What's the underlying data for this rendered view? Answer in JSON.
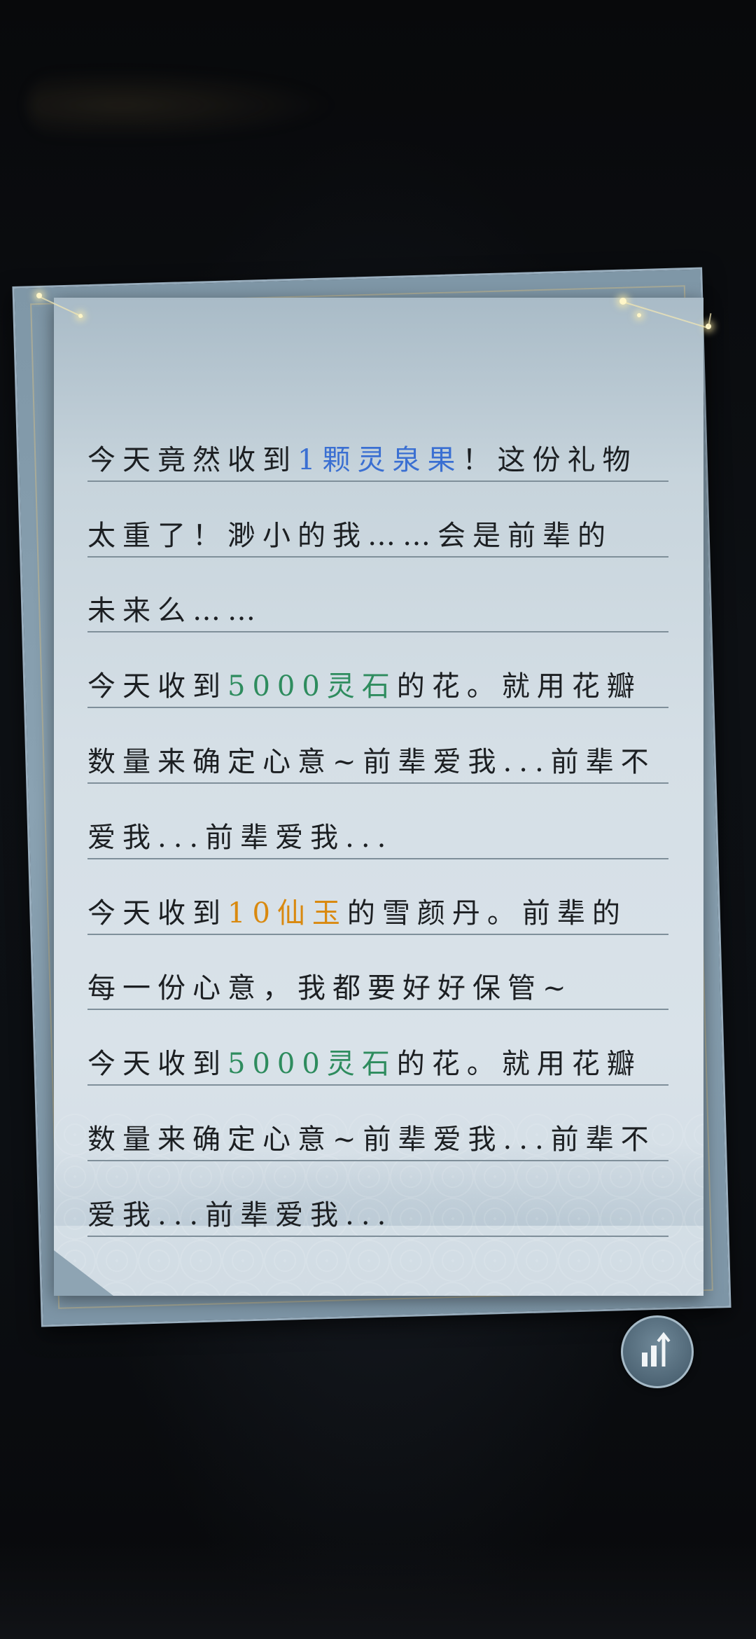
{
  "diary": {
    "lines": [
      {
        "segments": [
          {
            "text": "今天竟然收到",
            "style": "normal"
          },
          {
            "text": "1颗灵泉果",
            "style": "blue"
          },
          {
            "text": "！这份礼物",
            "style": "normal"
          }
        ]
      },
      {
        "segments": [
          {
            "text": "太重了！渺小的我……会是前辈的",
            "style": "normal"
          }
        ]
      },
      {
        "segments": [
          {
            "text": "未来么……",
            "style": "normal"
          }
        ]
      },
      {
        "segments": [
          {
            "text": "今天收到",
            "style": "normal"
          },
          {
            "text": "5000灵石",
            "style": "green"
          },
          {
            "text": "的花。就用花瓣",
            "style": "normal"
          }
        ]
      },
      {
        "segments": [
          {
            "text": "数量来确定心意~前辈爱我...前辈不",
            "style": "normal"
          }
        ]
      },
      {
        "segments": [
          {
            "text": "爱我...前辈爱我...",
            "style": "normal"
          }
        ]
      },
      {
        "segments": [
          {
            "text": "今天收到",
            "style": "normal"
          },
          {
            "text": "10仙玉",
            "style": "orange"
          },
          {
            "text": "的雪颜丹。前辈的",
            "style": "normal"
          }
        ]
      },
      {
        "segments": [
          {
            "text": "每一份心意，我都要好好保管~",
            "style": "normal"
          }
        ]
      },
      {
        "segments": [
          {
            "text": "今天收到",
            "style": "normal"
          },
          {
            "text": "5000灵石",
            "style": "green"
          },
          {
            "text": "的花。就用花瓣",
            "style": "normal"
          }
        ]
      },
      {
        "segments": [
          {
            "text": "数量来确定心意~前辈爱我...前辈不",
            "style": "normal"
          }
        ]
      },
      {
        "segments": [
          {
            "text": "爱我...前辈爱我...",
            "style": "normal"
          }
        ]
      }
    ]
  },
  "colors": {
    "blue": "#3a6fd2",
    "green": "#2e8c5e",
    "orange": "#d9890f",
    "text": "#1c1f22",
    "background": "#0a0c0f"
  },
  "icons": {
    "chart_button": "bar-chart-up-arrow-icon",
    "decoration": "constellation-icon"
  }
}
